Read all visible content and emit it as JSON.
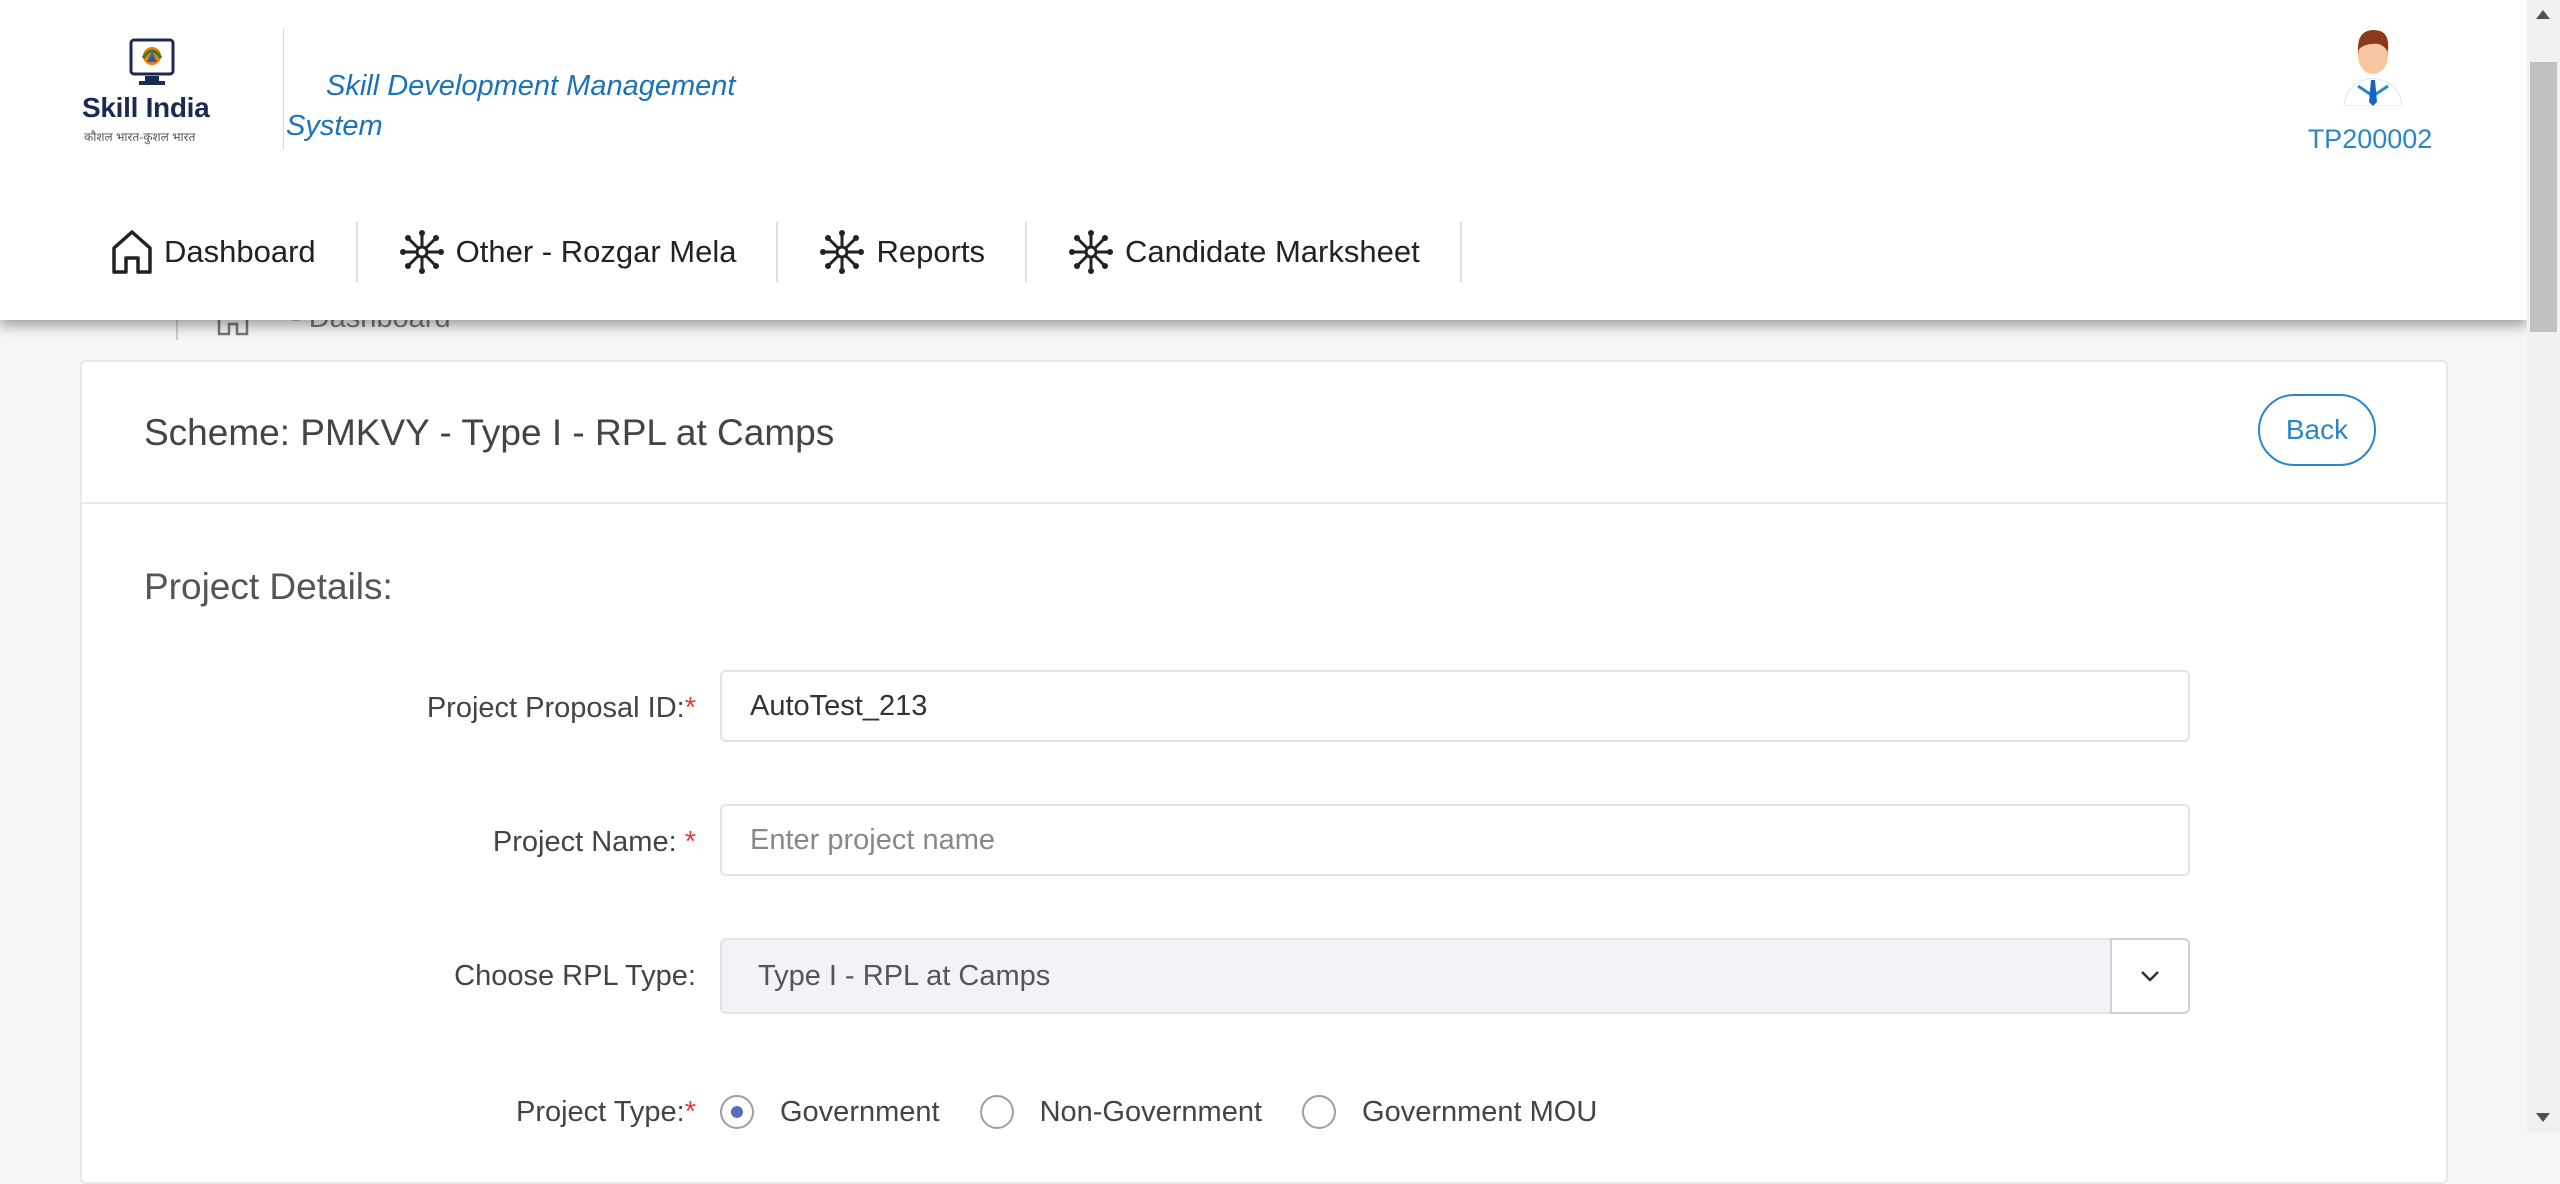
{
  "header": {
    "logo_text": "Skill India",
    "logo_tagline": "कौशल भारत-कुशल भारत",
    "app_title": "Skill Development Management System",
    "user_id": "TP200002"
  },
  "nav": {
    "items": [
      {
        "label": "Dashboard",
        "icon": "home-icon"
      },
      {
        "label": "Other - Rozgar Mela",
        "icon": "network-icon"
      },
      {
        "label": "Reports",
        "icon": "network-icon"
      },
      {
        "label": "Candidate Marksheet",
        "icon": "network-icon"
      }
    ]
  },
  "breadcrumb": {
    "current": "- Dashboard",
    "home_icon": "home-icon"
  },
  "card": {
    "scheme_title": "Scheme: PMKVY - Type I - RPL at Camps",
    "back_label": "Back",
    "section_title": "Project Details:"
  },
  "form": {
    "proposal_id": {
      "label": "Project Proposal ID:",
      "required": "*",
      "value": "AutoTest_213"
    },
    "project_name": {
      "label": "Project Name: ",
      "required": "*",
      "placeholder": "Enter project name"
    },
    "rpl_type": {
      "label": "Choose RPL Type:",
      "value": "Type I - RPL at Camps"
    },
    "project_type": {
      "label": "Project Type:",
      "required": "*",
      "options": [
        "Government",
        "Non-Government",
        "Government MOU"
      ],
      "selected": "Government"
    }
  },
  "colors": {
    "accent": "#2b86c8",
    "title_blue": "#1b72b8",
    "required": "#e53935"
  }
}
